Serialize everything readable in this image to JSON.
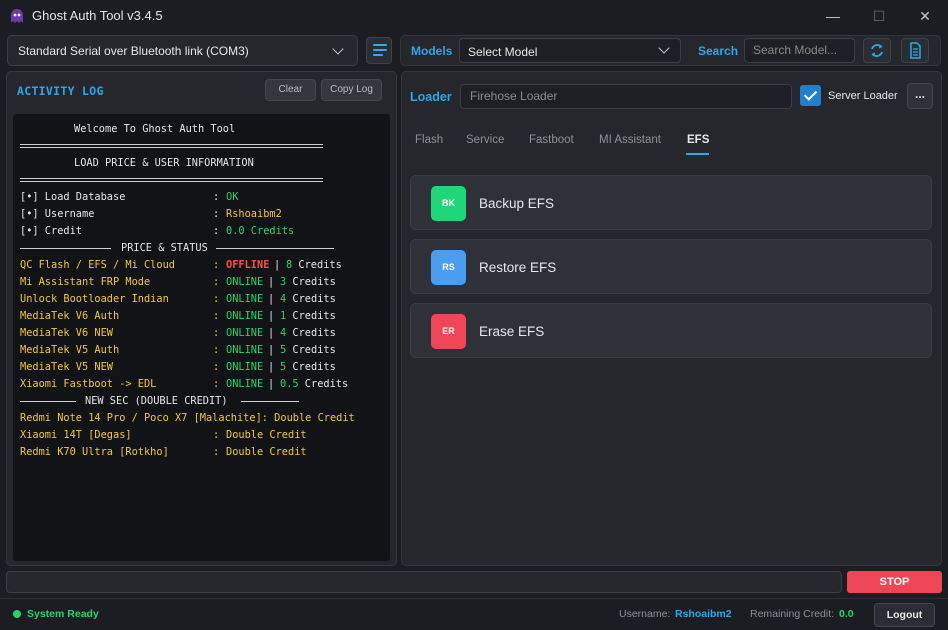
{
  "window": {
    "title": "Ghost Auth Tool v3.4.5",
    "min_glyph": "—",
    "max_glyph": "☐",
    "close_glyph": "✕"
  },
  "port": {
    "selected": "Standard Serial over Bluetooth link (COM3)"
  },
  "models": {
    "label": "Models",
    "selected": "Select Model"
  },
  "search": {
    "label": "Search",
    "placeholder": "Search Model..."
  },
  "log": {
    "title": "ACTIVITY LOG",
    "clear_label": "Clear",
    "copy_label": "Copy Log",
    "welcome": "Welcome To Ghost Auth Tool",
    "section_load": "LOAD PRICE & USER INFORMATION",
    "info": [
      {
        "key": "[•] Load Database",
        "value": "OK"
      },
      {
        "key": "[•] Username",
        "value": "Rshoaibm2"
      },
      {
        "key": "[•] Credit",
        "value": "0.0 Credits"
      }
    ],
    "section_price": "PRICE & STATUS",
    "price": [
      {
        "name": "QC Flash / EFS / Mi Cloud",
        "status": "OFFLINE",
        "credits": "8 Credits"
      },
      {
        "name": "Mi Assistant FRP Mode",
        "status": "ONLINE",
        "credits": "3 Credits"
      },
      {
        "name": "Unlock Bootloader Indian",
        "status": "ONLINE",
        "credits": "4 Credits"
      },
      {
        "name": "MediaTek V6 Auth",
        "status": "ONLINE",
        "credits": "1 Credits"
      },
      {
        "name": "MediaTek V6 NEW",
        "status": "ONLINE",
        "credits": "4 Credits"
      },
      {
        "name": "MediaTek V5 Auth",
        "status": "ONLINE",
        "credits": "5 Credits"
      },
      {
        "name": "MediaTek V5 NEW",
        "status": "ONLINE",
        "credits": "5 Credits"
      },
      {
        "name": "Xiaomi Fastboot -> EDL",
        "status": "ONLINE",
        "credits": "0.5 Credits"
      }
    ],
    "section_new": "NEW SEC (DOUBLE CREDIT)",
    "new_sec": [
      {
        "name": "Redmi Note 14 Pro / Poco X7 [Malachite]",
        "value": "Double Credit"
      },
      {
        "name": "Xiaomi 14T [Degas]",
        "value": "Double Credit"
      },
      {
        "name": "Redmi K70 Ultra [Rotkho]",
        "value": "Double Credit"
      }
    ]
  },
  "loader": {
    "label": "Loader",
    "placeholder": "Firehose Loader",
    "server_loader_label": "Server Loader",
    "server_loader_checked": true,
    "more_label": "..."
  },
  "tabs": [
    "Flash",
    "Service",
    "Fastboot",
    "MI Assistant",
    "EFS"
  ],
  "active_tab": "EFS",
  "actions": [
    {
      "badge": "BK",
      "label": "Backup EFS",
      "color": "#1fd67a"
    },
    {
      "badge": "RS",
      "label": "Restore EFS",
      "color": "#4a9df0"
    },
    {
      "badge": "ER",
      "label": "Erase EFS",
      "color": "#ee4656"
    }
  ],
  "stop_label": "STOP",
  "status": {
    "text": "System Ready",
    "username_label": "Username:",
    "username": "Rshoaibm2",
    "credit_label": "Remaining Credit:",
    "credit": "0.0",
    "logout_label": "Logout"
  },
  "colors": {
    "accent": "#2ea7ea",
    "online": "#22d66b",
    "offline": "#ff4b4b",
    "highlight": "#f0c93a"
  }
}
